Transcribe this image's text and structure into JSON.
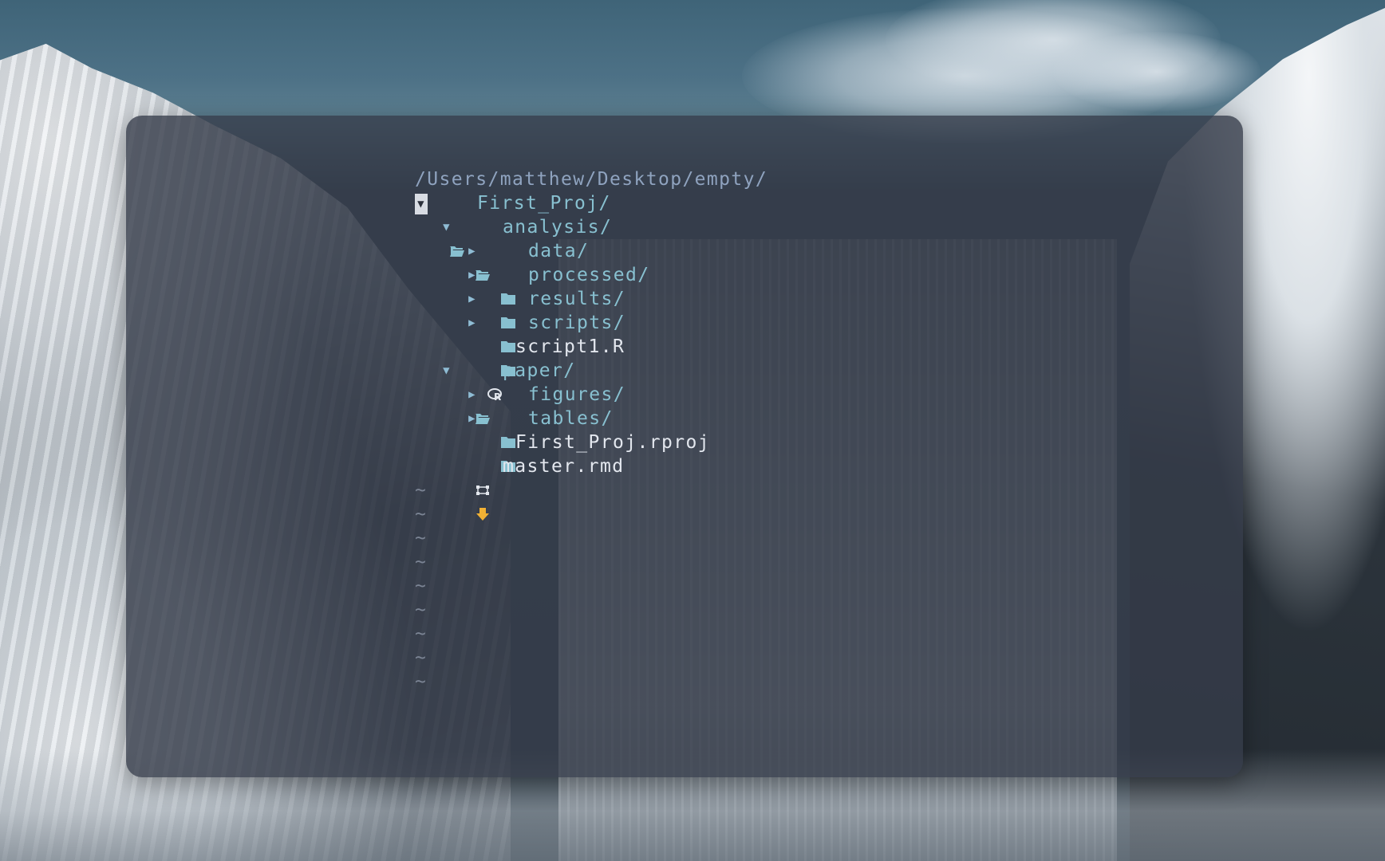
{
  "tree": {
    "root_path": "/Users/matthew/Desktop/empty/",
    "nodes": [
      {
        "label": "First_Proj/",
        "toggle": "▼",
        "icon": "folder-open-icon"
      },
      {
        "label": "analysis/",
        "toggle": "▼",
        "icon": "folder-open-icon"
      },
      {
        "label": "data/",
        "toggle": "▶",
        "icon": "folder-closed-icon"
      },
      {
        "label": "processed/",
        "toggle": "▶",
        "icon": "folder-closed-icon"
      },
      {
        "label": "results/",
        "toggle": "▶",
        "icon": "folder-closed-icon"
      },
      {
        "label": "scripts/",
        "toggle": "▶",
        "icon": "folder-closed-icon"
      },
      {
        "label": "script1.R",
        "icon": "r-file-icon"
      },
      {
        "label": "paper/",
        "toggle": "▼",
        "icon": "folder-open-icon"
      },
      {
        "label": "figures/",
        "toggle": "▶",
        "icon": "folder-closed-icon"
      },
      {
        "label": "tables/",
        "toggle": "▶",
        "icon": "folder-closed-icon"
      },
      {
        "label": "First_Proj.rproj",
        "icon": "rproj-file-icon"
      },
      {
        "label": "master.rmd",
        "icon": "rmd-file-icon"
      }
    ],
    "empty_line_marker": "~"
  },
  "colors": {
    "directory": "#88c0d0",
    "file": "#e3e7ee",
    "root_path": "#8fa3bf",
    "rmd_icon": "#f2b134",
    "window_background": "#363c4a"
  }
}
